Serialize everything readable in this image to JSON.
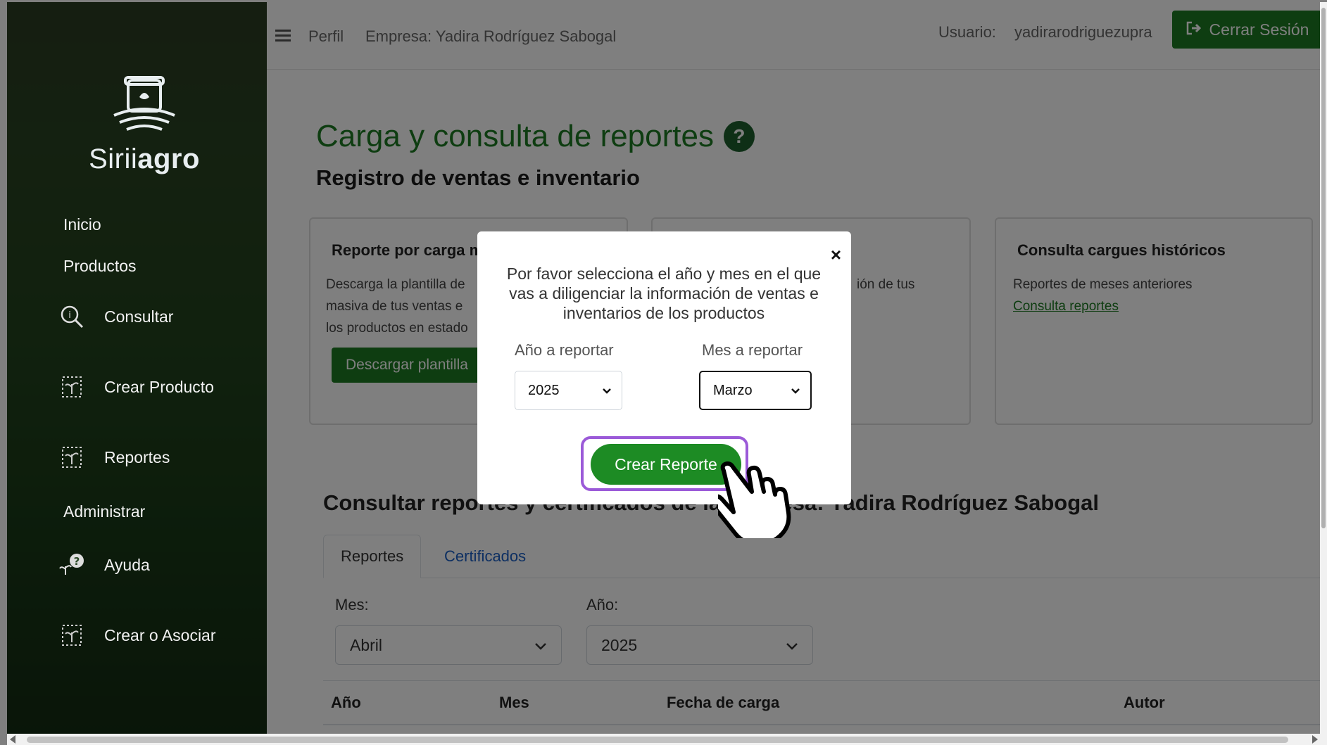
{
  "sidebar": {
    "logo": {
      "text_light": "Sirii",
      "text_bold": "agro"
    },
    "items": [
      {
        "label": "Inicio"
      },
      {
        "label": "Productos"
      },
      {
        "label": "Consultar"
      },
      {
        "label": "Crear Producto"
      },
      {
        "label": "Reportes"
      },
      {
        "label": "Administrar"
      },
      {
        "label": "Ayuda"
      },
      {
        "label": "Crear o Asociar"
      }
    ]
  },
  "topbar": {
    "perfil": "Perfil",
    "empresa": "Empresa: Yadira Rodríguez Sabogal",
    "usuario_label": "Usuario:",
    "usuario_value": "yadirarodriguezupra",
    "logout_label": "Cerrar Sesión"
  },
  "page": {
    "title": "Carga y consulta de reportes",
    "help_symbol": "?",
    "subtitle": "Registro de ventas e inventario"
  },
  "cards": [
    {
      "title": "Reporte por carga m",
      "lines": [
        "Descarga la plantilla de",
        "masiva de tus ventas e",
        "los productos en estado"
      ],
      "button": "Descargar plantilla"
    },
    {
      "title": "",
      "lines": [
        "ión de tus"
      ]
    },
    {
      "title": "Consulta cargues históricos",
      "lines": [
        "Reportes de meses anteriores"
      ],
      "link": "Consulta reportes"
    }
  ],
  "consult": {
    "title": "Consultar reportes y certificados de la empresa: Yadira Rodríguez Sabogal",
    "tabs": [
      "Reportes",
      "Certificados"
    ],
    "mes_label": "Mes:",
    "mes_value": "Abril",
    "anio_label": "Año:",
    "anio_value": "2025",
    "columns": [
      "Año",
      "Mes",
      "Fecha de carga",
      "Autor"
    ]
  },
  "modal": {
    "close": "×",
    "message": "Por favor selecciona el año y mes en el que vas a diligenciar la información de ventas e inventarios de los productos",
    "year_label": "Año a reportar",
    "year_value": "2025",
    "month_label": "Mes a reportar",
    "month_value": "Marzo",
    "create_button": "Crear Reporte"
  },
  "colors": {
    "brand_green": "#1d7a22",
    "highlight_purple": "#9b5ad8",
    "link_blue": "#1b5fc4"
  }
}
